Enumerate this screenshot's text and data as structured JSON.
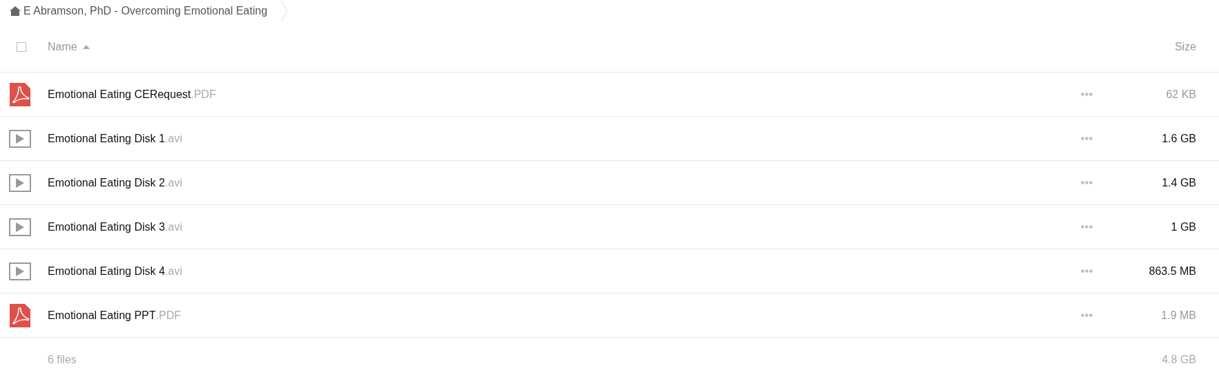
{
  "breadcrumb": {
    "title": "E Abramson, PhD - Overcoming Emotional Eating"
  },
  "header": {
    "select_all": {
      "checked": false
    },
    "name_column": "Name",
    "sort_ascending": true,
    "size_column": "Size"
  },
  "files": [
    {
      "kind": "pdf",
      "name": "Emotional Eating CERequest",
      "extension": ".PDF",
      "size": "62 KB",
      "size_strong": false
    },
    {
      "kind": "video",
      "name": "Emotional Eating Disk 1",
      "extension": ".avi",
      "size": "1.6 GB",
      "size_strong": true
    },
    {
      "kind": "video",
      "name": "Emotional Eating Disk 2",
      "extension": ".avi",
      "size": "1.4 GB",
      "size_strong": true
    },
    {
      "kind": "video",
      "name": "Emotional Eating Disk 3",
      "extension": ".avi",
      "size": "1 GB",
      "size_strong": true
    },
    {
      "kind": "video",
      "name": "Emotional Eating Disk 4",
      "extension": ".avi",
      "size": "863.5 MB",
      "size_strong": true
    },
    {
      "kind": "pdf",
      "name": "Emotional Eating PPT",
      "extension": ".PDF",
      "size": "1.9 MB",
      "size_strong": false
    }
  ],
  "footer": {
    "count": "6 files",
    "total": "4.8 GB"
  }
}
